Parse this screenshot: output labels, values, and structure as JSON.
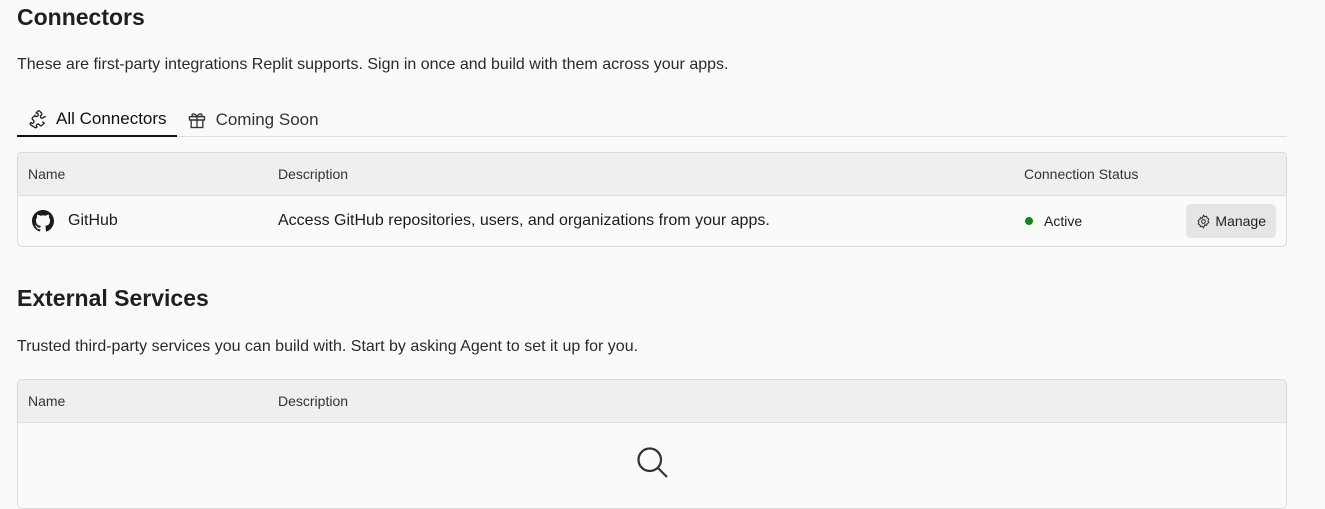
{
  "connectors": {
    "title": "Connectors",
    "description": "These are first-party integrations Replit supports. Sign in once and build with them across your apps.",
    "tabs": [
      {
        "label": "All Connectors",
        "icon": "puzzle-icon",
        "active": true
      },
      {
        "label": "Coming Soon",
        "icon": "gift-icon",
        "active": false
      }
    ],
    "columns": [
      "Name",
      "Description",
      "Connection Status"
    ],
    "rows": [
      {
        "name": "GitHub",
        "icon": "github-icon",
        "description": "Access GitHub repositories, users, and organizations from your apps.",
        "status": "Active",
        "status_color": "#118a11",
        "action": "Manage"
      }
    ]
  },
  "external": {
    "title": "External Services",
    "description": "Trusted third-party services you can build with. Start by asking Agent to set it up for you.",
    "columns": [
      "Name",
      "Description"
    ],
    "empty_icon": "search-icon"
  }
}
